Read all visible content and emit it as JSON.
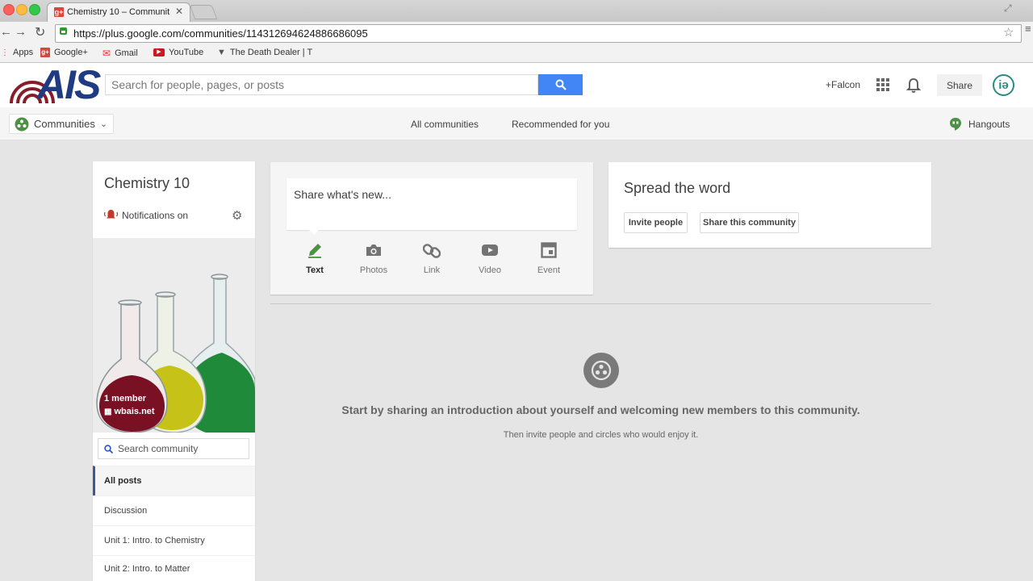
{
  "browser": {
    "tab_title": "Chemistry 10 – Communit",
    "url": "https://plus.google.com/communities/114312694624886686095",
    "bookmarks": [
      {
        "label": "Apps"
      },
      {
        "label": "Google+"
      },
      {
        "label": "Gmail"
      },
      {
        "label": "YouTube"
      },
      {
        "label": "The Death Dealer | T"
      }
    ]
  },
  "header": {
    "logo_text": "AIS",
    "search_placeholder": "Search for people, pages, or posts",
    "user_link": "+Falcon",
    "share_label": "Share"
  },
  "subnav": {
    "communities_label": "Communities",
    "all_communities": "All communities",
    "recommended": "Recommended for you",
    "hangouts": "Hangouts"
  },
  "community": {
    "name": "Chemistry 10",
    "notifications": "Notifications on",
    "members": "1 member",
    "domain": "wbais.net",
    "search_placeholder": "Search community",
    "nav": [
      "All posts",
      "Discussion",
      "Unit 1: Intro. to Chemistry",
      "Unit 2: Intro. to Matter"
    ]
  },
  "share_box": {
    "prompt": "Share what's new...",
    "actions": [
      {
        "label": "Text",
        "icon": "pencil-icon"
      },
      {
        "label": "Photos",
        "icon": "camera-icon"
      },
      {
        "label": "Link",
        "icon": "link-icon"
      },
      {
        "label": "Video",
        "icon": "video-icon"
      },
      {
        "label": "Event",
        "icon": "calendar-icon"
      }
    ]
  },
  "spread": {
    "title": "Spread the word",
    "invite": "Invite people",
    "share_community": "Share this community"
  },
  "empty_state": {
    "headline": "Start by sharing an introduction about yourself and welcoming new members to this community.",
    "subtext": "Then invite people and circles who would enjoy it."
  },
  "colors": {
    "accent_blue": "#4285f4",
    "communities_green": "#4d9144",
    "nav_selected_border": "#3b5998"
  }
}
